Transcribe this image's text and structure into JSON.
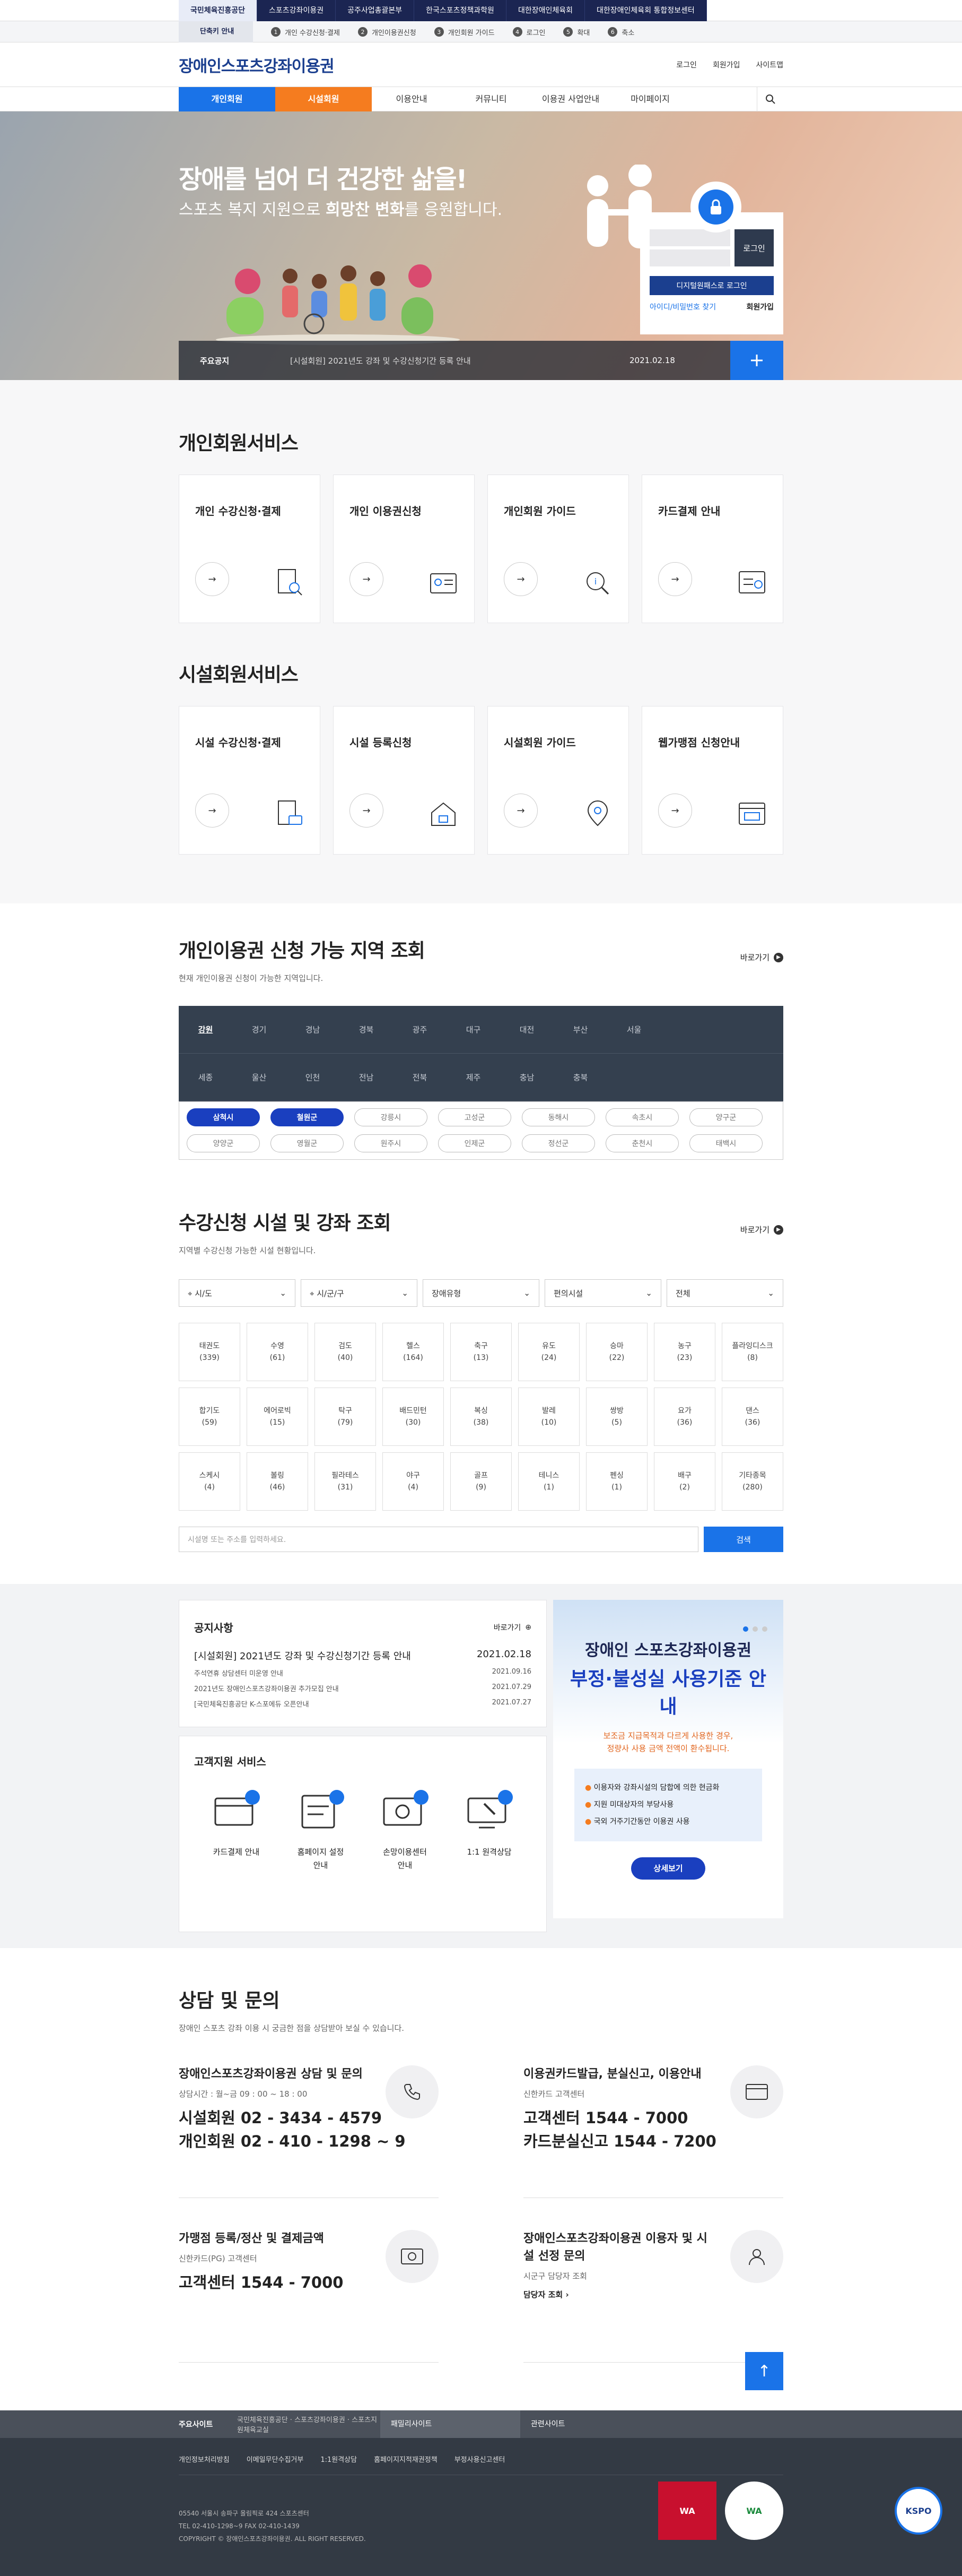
{
  "orgs": [
    "국민체육진흥공단",
    "스포츠강좌이용권",
    "공주사업총괄본부",
    "한국스포츠정책과학원",
    "대한장애인체육회",
    "대한장애인체육회 통합정보센터"
  ],
  "shortcut": {
    "toggle": "단축키 안내",
    "steps": [
      {
        "num": "1",
        "label": "개인 수강신청·결제"
      },
      {
        "num": "2",
        "label": "개인이용권신청"
      },
      {
        "num": "3",
        "label": "개인회원 가이드"
      },
      {
        "num": "4",
        "label": "로그인"
      },
      {
        "num": "5",
        "label": "확대"
      },
      {
        "num": "6",
        "label": "축소"
      }
    ]
  },
  "header": {
    "logo": "장애인스포츠강좌이용권",
    "util": [
      "로그인",
      "회원가입",
      "사이트맵"
    ]
  },
  "gnb": {
    "tabs": [
      "개인회원",
      "시설회원"
    ],
    "menu": [
      "이용안내",
      "커뮤니티",
      "이용권 사업안내",
      "마이페이지"
    ]
  },
  "hero": {
    "title": "장애를 넘어 더 건강한 삶을!",
    "sub_pre": "스포츠 복지 지원으로 ",
    "sub_bold": "희망찬 변화",
    "sub_post": "를 응원합니다.",
    "login_btn": "로그인",
    "digital_btn": "디지털원패스로 로그인",
    "find": "아이디/비밀번호 찾기",
    "join": "회원가입",
    "notice_label": "주요공지",
    "notice_text": "[시설회원] 2021년도 강좌 및 수강신청기간 등록 안내",
    "notice_date": "2021.02.18"
  },
  "personal": {
    "title": "개인회원서비스",
    "cards": [
      "개인 수강신청·결제",
      "개인 이용권신청",
      "개인회원 가이드",
      "카드결제 안내"
    ]
  },
  "facility": {
    "title": "시설회원서비스",
    "cards": [
      "시설 수강신청·결제",
      "시설 등록신청",
      "시설회원 가이드",
      "웹가맹점 신청안내"
    ]
  },
  "region": {
    "title": "개인이용권 신청 가능 지역 조회",
    "desc": "현재 개인이용권 신청이 가능한 지역입니다.",
    "more": "바로가기",
    "row1": [
      "강원",
      "경기",
      "경남",
      "경북",
      "광주",
      "대구",
      "대전",
      "부산",
      "서울"
    ],
    "row2": [
      "세종",
      "울산",
      "인천",
      "전남",
      "전북",
      "제주",
      "충남",
      "충북"
    ],
    "chips": [
      "삼척시",
      "철원군",
      "강릉시",
      "고성군",
      "동해시",
      "속초시",
      "양구군",
      "양양군",
      "영월군",
      "원주시",
      "인제군",
      "정선군",
      "춘천시",
      "태백시"
    ]
  },
  "course": {
    "title": "수강신청 시설 및 강좌 조회",
    "desc": "지역별 수강신청 가능한 시설 현황입니다.",
    "more": "바로가기",
    "filters": [
      "시/도",
      "시/군/구",
      "장애유형",
      "편의시설",
      "전체"
    ],
    "sports": [
      {
        "name": "태권도",
        "count": "(339)"
      },
      {
        "name": "수영",
        "count": "(61)"
      },
      {
        "name": "검도",
        "count": "(40)"
      },
      {
        "name": "헬스",
        "count": "(164)"
      },
      {
        "name": "축구",
        "count": "(13)"
      },
      {
        "name": "유도",
        "count": "(24)"
      },
      {
        "name": "승마",
        "count": "(22)"
      },
      {
        "name": "농구",
        "count": "(23)"
      },
      {
        "name": "플라잉디스크",
        "count": "(8)"
      },
      {
        "name": "합기도",
        "count": "(59)"
      },
      {
        "name": "에어로빅",
        "count": "(15)"
      },
      {
        "name": "탁구",
        "count": "(79)"
      },
      {
        "name": "배드민턴",
        "count": "(30)"
      },
      {
        "name": "복싱",
        "count": "(38)"
      },
      {
        "name": "발레",
        "count": "(10)"
      },
      {
        "name": "쌍방",
        "count": "(5)"
      },
      {
        "name": "요가",
        "count": "(36)"
      },
      {
        "name": "댄스",
        "count": "(36)"
      },
      {
        "name": "스케시",
        "count": "(4)"
      },
      {
        "name": "볼링",
        "count": "(46)"
      },
      {
        "name": "필라테스",
        "count": "(31)"
      },
      {
        "name": "야구",
        "count": "(4)"
      },
      {
        "name": "골프",
        "count": "(9)"
      },
      {
        "name": "테니스",
        "count": "(1)"
      },
      {
        "name": "펜싱",
        "count": "(1)"
      },
      {
        "name": "배구",
        "count": "(2)"
      },
      {
        "name": "기타종목",
        "count": "(280)"
      }
    ],
    "search_placeholder": "시설명 또는 주소를 입력하세요.",
    "search_btn": "검색"
  },
  "notice": {
    "title": "공지사항",
    "more": "바로가기",
    "items": [
      {
        "text": "[시설회원] 2021년도 강좌 및 수강신청기간 등록 안내",
        "date": "2021.02.18"
      },
      {
        "text": "주석연휴 상담센터 미운영 안내",
        "date": "2021.09.16"
      },
      {
        "text": "2021년도 장애인스포츠강좌이용권 추가모집 안내",
        "date": "2021.07.29"
      },
      {
        "text": "[국민체육진흥공단 K-스포에듀 오픈안내",
        "date": "2021.07.27"
      }
    ]
  },
  "cs": {
    "title": "고객지원 서비스",
    "items": [
      {
        "l1": "카드결제 안내",
        "l2": ""
      },
      {
        "l1": "홈페이지 설정",
        "l2": "안내"
      },
      {
        "l1": "손망이용센터",
        "l2": "안내"
      },
      {
        "l1": "1:1 원격상담",
        "l2": ""
      }
    ]
  },
  "banner": {
    "t1": "장애인 스포츠강좌이용권",
    "t2": "부정·불성실 사용기준 안내",
    "t3a": "보조금 지급목적과 다르게 사용한 경우,",
    "t3b": "정량사 사용 금액 전액이 환수됩니다.",
    "list": [
      "이용자와 강좌시설의 담합에 의한 현금화",
      "지원 미대상자의 부당사용",
      "국외 거주기간동안 이용권 사용"
    ],
    "btn": "상세보기"
  },
  "contact": {
    "title": "상담 및 문의",
    "desc": "장애인 스포츠 강좌 이용 시 궁금한 점을 상담받아 보실 수 있습니다.",
    "items": [
      {
        "t": "장애인스포츠강좌이용권 상담 및 문의",
        "s": "상담시간 : 월~금 09 : 00 ~ 18 : 00",
        "big1": "시설회원 02 - 3434 - 4579",
        "big2": "개인회원 02 - 410 - 1298 ~ 9",
        "link": ""
      },
      {
        "t": "이용권카드발급, 분실신고, 이용안내",
        "s": "신한카드 고객센터",
        "big1": "고객센터 1544 - 7000",
        "big2": "카드분실신고 1544 - 7200",
        "link": ""
      },
      {
        "t": "가맹점 등록/정산 및 결제금액",
        "s": "신한카드(PG) 고객센터",
        "big1": "고객센터 1544 - 7000",
        "big2": "",
        "link": ""
      },
      {
        "t": "장애인스포츠강좌이용권 이용자 및 시설 선정 문의",
        "s": "시군구 담당자 조회",
        "big1": "",
        "big2": "",
        "link": "담당자 조회"
      }
    ]
  },
  "footer": {
    "sites_label": "주요사이트",
    "site1": "국민체육진흥공단 · 스포츠강좌이용권 · 스포츠지원체육교실",
    "site2": "패밀리사이트",
    "site3": "관련사이트",
    "links": [
      "개인정보처리방침",
      "이메일무단수집거부",
      "1:1원격상담",
      "홈페이지지적재권정책",
      "부정사용신고센터"
    ],
    "addr1": "05540 서울시 송파구 올림픽로 424 스포츠센터",
    "addr2": "TEL 02-410-1298~9    FAX 02-410-1439",
    "copy": "COPYRIGHT © 장애인스포츠강좌이용권. ALL RIGHT RESERVED.",
    "badge1": "WA",
    "badge2": "WA",
    "kspo": "KSPO"
  }
}
